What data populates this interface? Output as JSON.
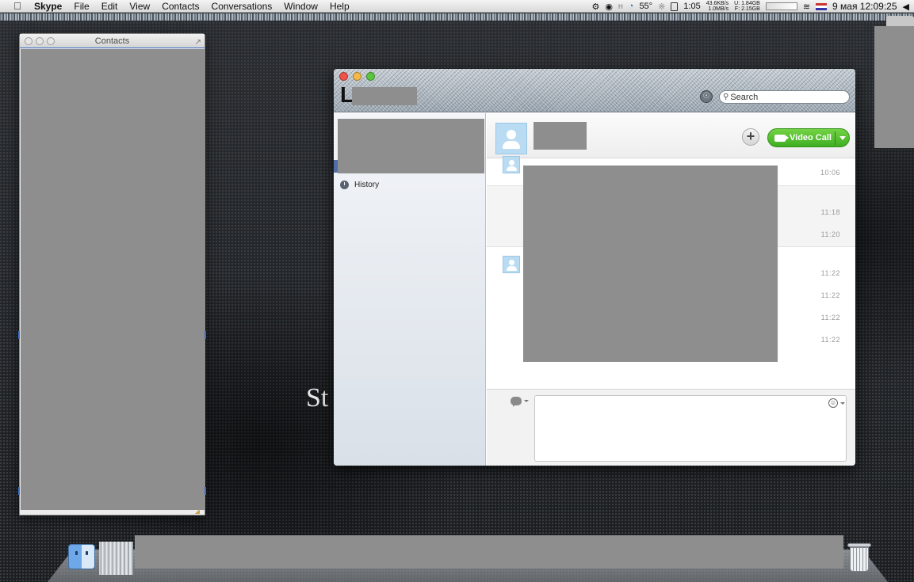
{
  "menubar": {
    "apple_icon": "apple-icon",
    "app_name": "Skype",
    "items": [
      "File",
      "Edit",
      "View",
      "Contacts",
      "Conversations",
      "Window",
      "Help"
    ],
    "status": {
      "temperature": "55°",
      "temp_prefix": "H",
      "battery_time": "1:05",
      "net_up": "43.6KB/s",
      "net_down": "1.0MB/s",
      "mem_u": "U: 1.84GB",
      "mem_f": "F: 2.15GB",
      "date_time": "9 мая 12:09:25"
    }
  },
  "contacts_window": {
    "title": "Contacts"
  },
  "desktop": {
    "text": "St"
  },
  "skype": {
    "profile_letter": "L",
    "search": {
      "placeholder": "Search"
    },
    "sidebar": {
      "history_label": "History"
    },
    "conversation": {
      "video_call_label": "Video Call",
      "timestamps": [
        "10:06",
        "11:18",
        "11:20",
        "11:22",
        "11:22",
        "11:22",
        "11:22"
      ]
    }
  }
}
